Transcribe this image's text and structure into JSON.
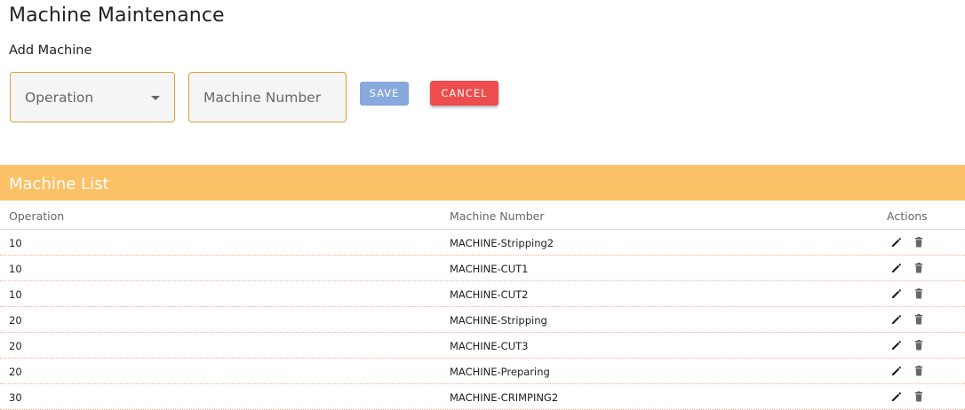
{
  "page": {
    "title": "Machine Maintenance"
  },
  "form": {
    "section_title": "Add Machine",
    "operation_placeholder": "Operation",
    "machine_number_placeholder": "Machine Number",
    "save_label": "SAVE",
    "cancel_label": "CANCEL"
  },
  "list": {
    "title": "Machine List",
    "columns": {
      "operation": "Operation",
      "machine_number": "Machine Number",
      "actions": "Actions"
    },
    "rows": [
      {
        "operation": "10",
        "machine_number": "MACHINE-Stripping2"
      },
      {
        "operation": "10",
        "machine_number": "MACHINE-CUT1"
      },
      {
        "operation": "10",
        "machine_number": "MACHINE-CUT2"
      },
      {
        "operation": "20",
        "machine_number": "MACHINE-Stripping"
      },
      {
        "operation": "20",
        "machine_number": "MACHINE-CUT3"
      },
      {
        "operation": "20",
        "machine_number": "MACHINE-Preparing"
      },
      {
        "operation": "30",
        "machine_number": "MACHINE-CRIMPING2"
      }
    ],
    "row_icons": [
      "pencil-icon",
      "trash-icon"
    ]
  },
  "colors": {
    "accent": "#fcc166",
    "field_border": "#e0a034",
    "save": "#87a9dc",
    "cancel": "#ee4d4d"
  }
}
